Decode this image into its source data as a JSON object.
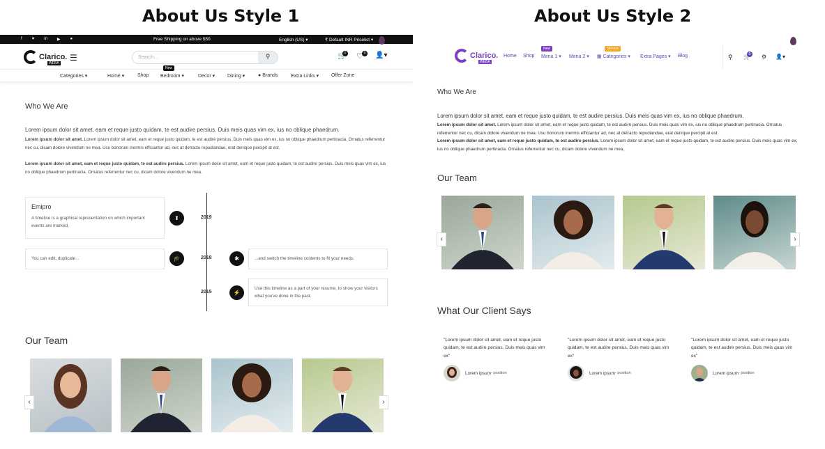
{
  "titles": {
    "style1": "About Us Style 1",
    "style2": "About Us Style 2"
  },
  "colors": {
    "brand_purple": "#7b3fc4",
    "accent_orange": "#f5a623",
    "nav_text": "#5b47b3"
  },
  "style1": {
    "topbar": {
      "social_icons": [
        "facebook-icon",
        "twitter-icon",
        "linkedin-icon",
        "youtube-icon",
        "github-icon"
      ],
      "shipping": "Free Shipping on above $50",
      "language": "English (US) ▾",
      "pricelist": "₹ Default INR Pricelist ▾"
    },
    "header": {
      "logo": "Clarico.",
      "logo_sub": "WEBA",
      "search_placeholder": "Search...",
      "cart_count": "0",
      "wishlist_count": "0"
    },
    "nav": {
      "categories": "Categories ▾",
      "home": "Home ▾",
      "shop": "Shop",
      "bedroom": "Bedroom ▾",
      "new_badge": "New",
      "decor": "Decor ▾",
      "dining": "Dining ▾",
      "brands": "Brands",
      "extra_links": "Extra Links ▾",
      "offer_zone": "Offer Zone"
    },
    "who_we_are": "Who We Are",
    "lead": "Lorem ipsum dolor sit amet, eam et reque justo quidam, te est audire persius. Duis meis quas vim ex, ius no oblique phaedrum.",
    "para1_bold": "Lorem ipsum dolor sit amet.",
    "para1": " Lorem ipsum dolor sit amet, eam et reque justo quidam, te est audire persius. Duis meis quas vim ex, ius no oblique phaedrum pertinacia. Ornatus referrentur nec cu, dicam dolore vivendum ne mea. Usu bonorum inermis efficiantur ad, nec at detracto repudiandae, erat denique percipit at est.",
    "para2_bold": "Lorem ipsum dolor sit amet, eam et reque justo quidam, te est audire persius.",
    "para2": " Lorem ipsum dolor sit amet, eam et reque justo quidam, te est audire persius. Duis meis quas vim ex, ius no oblique phaedrum pertinacia. Ornatus referrentur nec cu, dicam dolore vivendum ne mea.",
    "timeline": {
      "card1_title": "Emipro",
      "card1_text": "A timeline is a graphical representation on which important events are marked.",
      "card2_text": "You can edit, duplicate...",
      "card3_text": "...and switch the timeline contents to fit your needs.",
      "card4_text": "Use this timeline as a part of your resume, to show your visitors what you've done in the past.",
      "years": [
        "2019",
        "2018",
        "2015"
      ]
    },
    "our_team": "Our Team"
  },
  "style2": {
    "nav": {
      "home": "Home",
      "shop": "Shop",
      "menu1": "Menu 1 ▾",
      "new_badge": "New",
      "menu2": "Menu 2 ▾",
      "categories": "Categories ▾",
      "offer_badge": "OFFER",
      "extra_pages": "Extra Pages ▾",
      "blog": "Blog",
      "cart_count": "0"
    },
    "who_we_are": "Who We Are",
    "lead": "Lorem ipsum dolor sit amet, eam et reque justo quidam, te est audire persius. Duis meis quas vim ex, ius no oblique phaedrum.",
    "para1_bold": "Lorem ipsum dolor sit amet.",
    "para1": " Lorem ipsum dolor sit amet, eam et reque justo quidam, te est audire persius. Duis meis quas vim ex, ius no oblique phaedrum pertinacia. Ornatus referrentur nec cu, dicam dolore vivendum ne mea. Usu bonorum inermis efficiantur ad, nec at detracto repudiandae, erat denique percipit at est.",
    "para2_bold": "Lorem ipsum dolor sit amet, eam et reque justo quidam, te est audire persius.",
    "para2": " Lorem ipsum dolor sit amet, eam et reque justo quidam, te est audire persius. Duis meis quas vim ex, ius no oblique phaedrum pertinacia. Ornatus referrentur nec cu, dicam dolore vivendum ne mea,",
    "our_team": "Our Team",
    "client_heading": "What Our Client Says",
    "quote": "\"Lorem ipsum dolor sit amet, eam et reque justo quidam, te est audire persius. Duis meis quas vim ex\"",
    "client_name": "Lorem ipsum",
    "client_position": " - position"
  }
}
